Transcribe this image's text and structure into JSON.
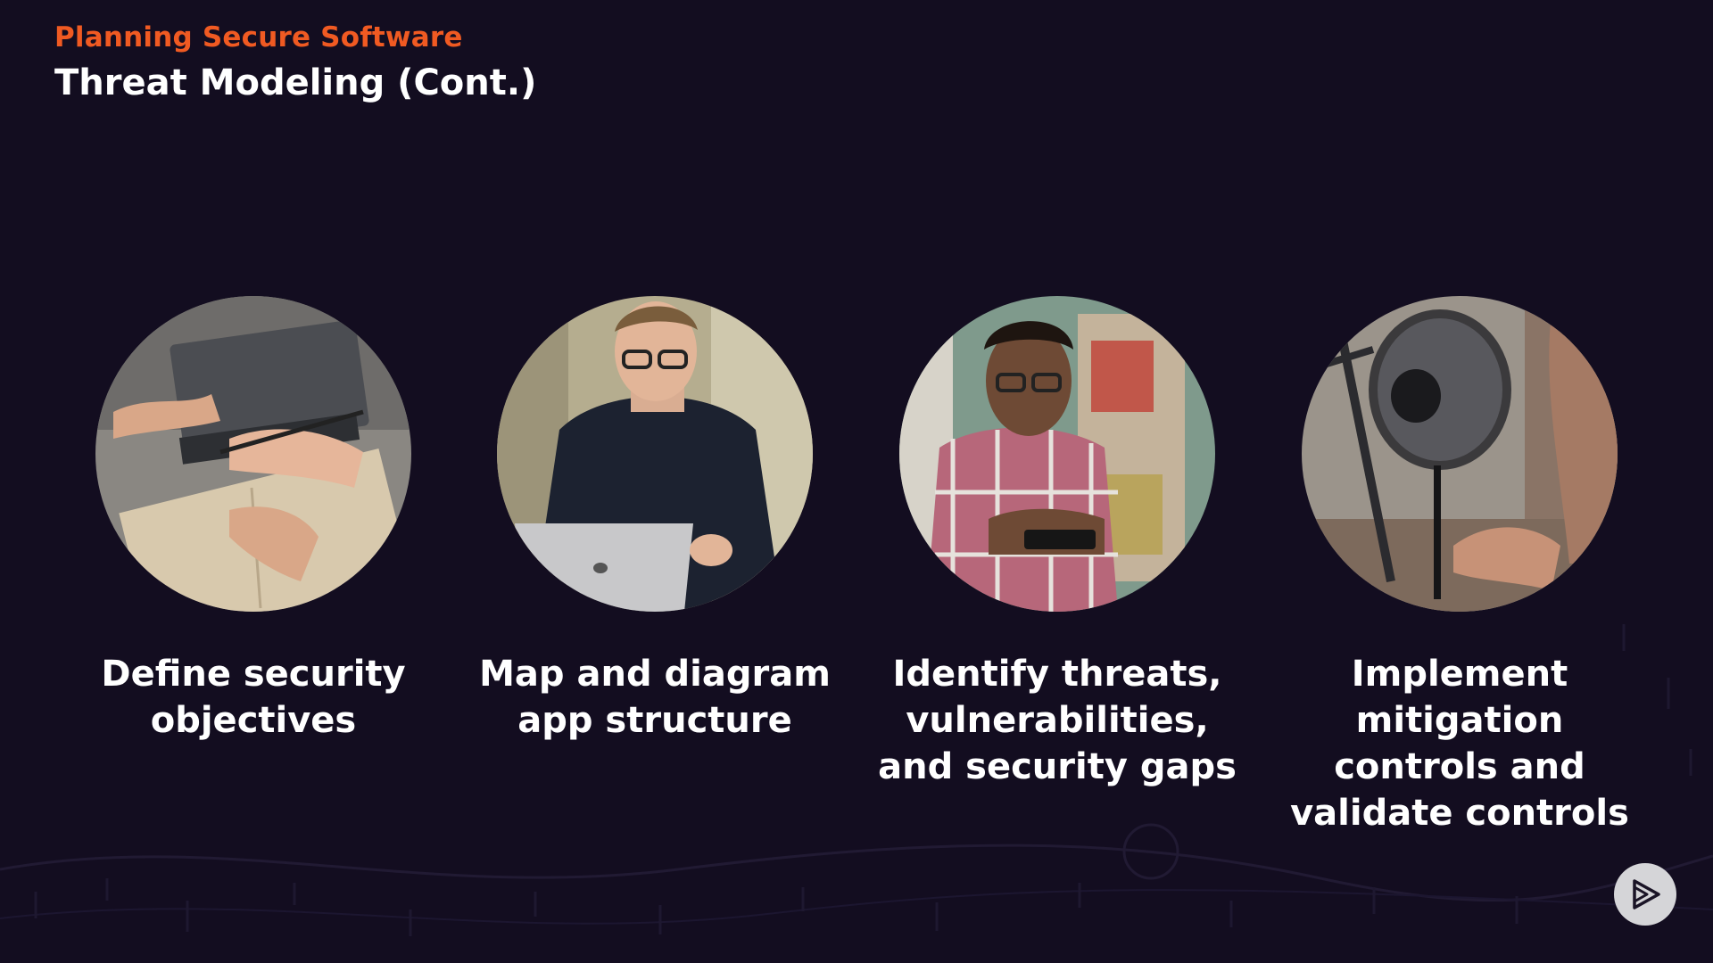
{
  "header": {
    "kicker": "Planning Secure Software",
    "title": "Threat Modeling (Cont.)"
  },
  "steps": [
    {
      "caption": "Define security objectives",
      "image": "hands-writing-notebook-photo"
    },
    {
      "caption": "Map and diagram app structure",
      "image": "man-working-on-laptop-photo"
    },
    {
      "caption": "Identify threats, vulnerabilities, and security gaps",
      "image": "man-using-phone-photo"
    },
    {
      "caption": "Implement mitigation controls and validate controls",
      "image": "podcast-microphone-photo"
    }
  ],
  "player": {
    "icon": "play-logo-icon"
  },
  "colors": {
    "background": "#130d20",
    "accent": "#f05a22",
    "text": "#ffffff"
  }
}
